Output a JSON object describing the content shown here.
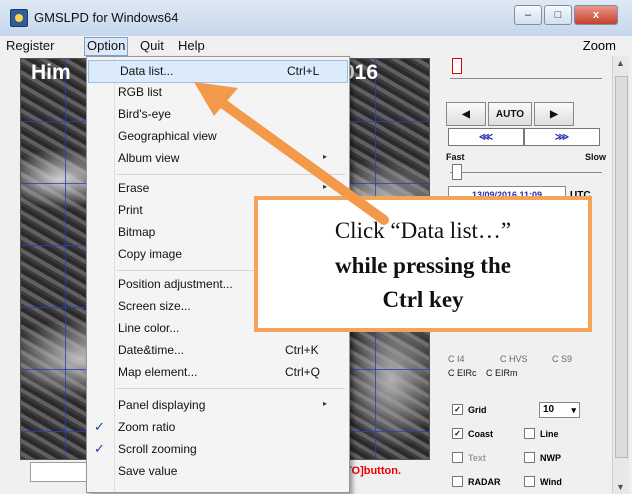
{
  "window": {
    "title": "GMSLPD for Windows64",
    "controls": {
      "minimize": "–",
      "maximize": "□",
      "close": "x"
    }
  },
  "menubar": {
    "items": [
      "Register",
      "Option",
      "Quit",
      "Help"
    ],
    "zoom": "Zoom"
  },
  "image": {
    "title_left": "Him",
    "title_right": "016"
  },
  "status": {
    "hint": "TO]button."
  },
  "dropdown": {
    "items": [
      {
        "label": "Data list...",
        "shortcut": "Ctrl+L"
      },
      {
        "label": "RGB list"
      },
      {
        "label": "Bird's-eye"
      },
      {
        "label": "Geographical view"
      },
      {
        "label": "Album view",
        "submenu": true
      },
      {
        "label": "Erase",
        "submenu": true
      },
      {
        "label": "Print"
      },
      {
        "label": "Bitmap"
      },
      {
        "label": "Copy image"
      },
      {
        "label": "Position adjustment..."
      },
      {
        "label": "Screen size..."
      },
      {
        "label": "Line color..."
      },
      {
        "label": "Date&time...",
        "shortcut": "Ctrl+K"
      },
      {
        "label": "Map element...",
        "shortcut": "Ctrl+Q"
      },
      {
        "label": "Panel displaying",
        "submenu": true
      },
      {
        "label": "Zoom ratio",
        "checked": true
      },
      {
        "label": "Scroll zooming",
        "checked": true
      },
      {
        "label": "Save value"
      }
    ],
    "checkmark": "✓",
    "submenu_arrow": "▸"
  },
  "panel": {
    "prev": "◀",
    "auto": "AUTO",
    "next": "▶",
    "fast_back": "⋘",
    "fast_fwd": "⋙",
    "fast": "Fast",
    "slow": "Slow",
    "datetime": "13/09/2016 11:09",
    "utc": "UTC",
    "radio_row1": [
      "I4",
      "HVS",
      "S9"
    ],
    "radio_row1_prefix": "C",
    "radio_row2": [
      "EIRc",
      "EIRm"
    ],
    "checks": {
      "grid": "Grid",
      "grid_value": "10",
      "coast": "Coast",
      "line": "Line",
      "text": "Text",
      "nwp": "NWP",
      "radar": "RADAR",
      "wind": "Wind"
    }
  },
  "callout": {
    "line1": "Click “Data list…”",
    "line2": "while pressing the",
    "line3": "Ctrl key"
  },
  "colors": {
    "callout_border": "#f3a35a",
    "arrow": "#f39a4a",
    "grid_lines": "#2c3fbf"
  }
}
